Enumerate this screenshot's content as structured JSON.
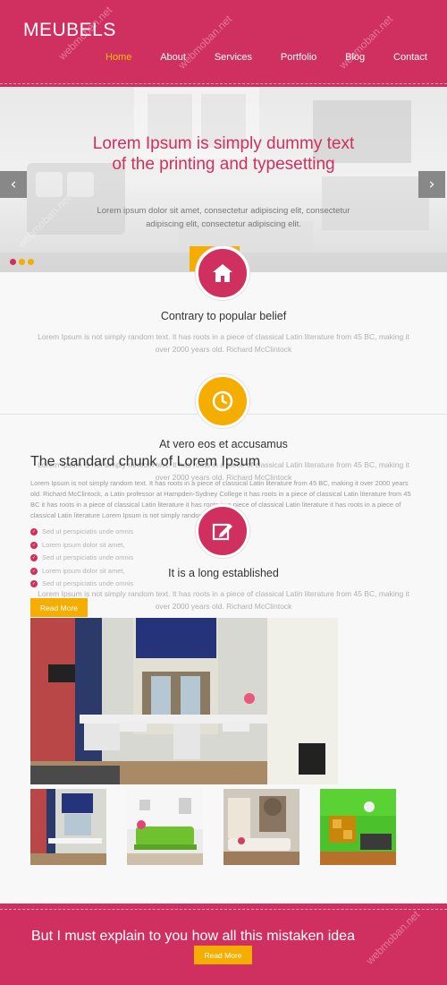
{
  "header": {
    "logo": "MEUBELS",
    "nav": [
      "Home",
      "About",
      "Services",
      "Portfolio",
      "Blog",
      "Contact"
    ],
    "active_nav": "Home"
  },
  "hero": {
    "title": "Lorem Ipsum is simply dummy text of the printing and typesetting",
    "text": "Lorem ipsum dolor sit amet, consectetur adipiscing elit, consectetur adipiscing elit, consectetur adipiscing elit.",
    "prev_icon": "chevron-left-icon",
    "next_icon": "chevron-right-icon"
  },
  "services": [
    {
      "icon": "home-icon",
      "color": "#d0305f",
      "title": "Contrary to popular belief",
      "text": "Lorem Ipsum is not simply random text. It has roots in a piece of classical Latin literature from 45 BC, making it over 2000 years old. Richard McClintock"
    },
    {
      "icon": "clock-icon",
      "color": "#f5ad00",
      "title": "At vero eos et accusamus",
      "text": "Lorem Ipsum is not simply random text. It has roots in a piece of classical Latin literature from 45 BC, making it over 2000 years old. Richard McClintock"
    },
    {
      "icon": "edit-icon",
      "color": "#d0305f",
      "title": "It is a long established",
      "text": "Lorem Ipsum is not simply random text. It has roots in a piece of classical Latin literature from 45 BC, making it over 2000 years old. Richard McClintock"
    }
  ],
  "chunk": {
    "title": "The standard chunk of Lorem Ipsum",
    "text": "Lorem Ipsum is not simply random text. It has roots in a piece of classical Latin literature from 45 BC, making it over 2000 years old. Richard McClintock, a Latin professor at Hampden-Sydney College it has roots in a piece of classical Latin literature from 45 BC it has roots in a piece of classical Latin literature it has roots in a piece of classical Latin literature it has roots in a piece of classical Latin literature Lorem Ipsum is not simply random text",
    "list": [
      "Sed ut perspiciatis unde omnis",
      "Lorem ipsum dolor sit amet,",
      "Sed ut perspiciatis unde omnis",
      "Lorem ipsum dolor sit amet,",
      "Sed ut perspiciatis unde omnis"
    ],
    "button": "Read More"
  },
  "footer": {
    "text": "But I must explain to you how all this mistaken idea",
    "button": "Read More"
  },
  "watermark": "webmoban.net",
  "colors": {
    "primary": "#d0305f",
    "accent": "#f5ad00"
  }
}
